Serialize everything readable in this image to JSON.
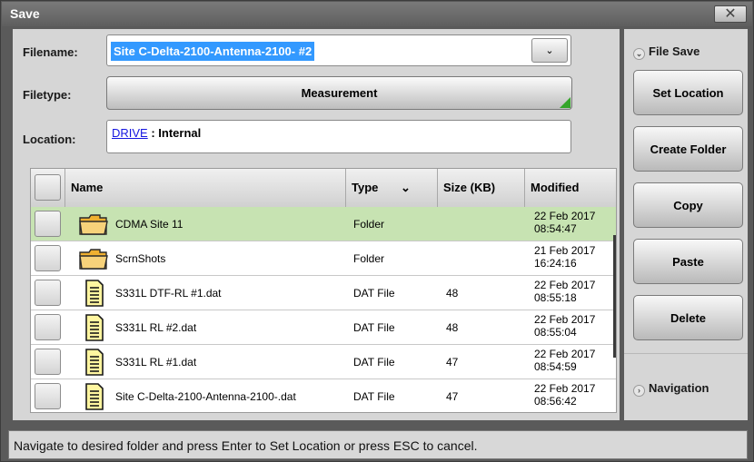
{
  "window": {
    "title": "Save",
    "close_glyph": "✕"
  },
  "form": {
    "filename_label": "Filename:",
    "filename_value": "Site C-Delta-2100-Antenna-2100- #2",
    "dropdown_glyph": "⌄",
    "filetype_label": "Filetype:",
    "filetype_value": "Measurement",
    "location_label": "Location:",
    "location_link": "DRIVE",
    "location_rest": " : Internal"
  },
  "table": {
    "columns": {
      "name": "Name",
      "type": "Type",
      "size": "Size (KB)",
      "modified": "Modified"
    },
    "type_sort_glyph": "⌄",
    "rows": [
      {
        "icon": "folder-icon",
        "name": "CDMA Site 11",
        "type": "Folder",
        "size": "",
        "modified_date": "22 Feb 2017",
        "modified_time": "08:54:47"
      },
      {
        "icon": "folder-icon",
        "name": "ScrnShots",
        "type": "Folder",
        "size": "",
        "modified_date": "21 Feb 2017",
        "modified_time": "16:24:16"
      },
      {
        "icon": "file-icon",
        "name": "S331L DTF-RL #1.dat",
        "type": "DAT File",
        "size": "48",
        "modified_date": "22 Feb 2017",
        "modified_time": "08:55:18"
      },
      {
        "icon": "file-icon",
        "name": "S331L RL #2.dat",
        "type": "DAT File",
        "size": "48",
        "modified_date": "22 Feb 2017",
        "modified_time": "08:55:04"
      },
      {
        "icon": "file-icon",
        "name": "S331L RL #1.dat",
        "type": "DAT File",
        "size": "47",
        "modified_date": "22 Feb 2017",
        "modified_time": "08:54:59"
      },
      {
        "icon": "file-icon",
        "name": "Site C-Delta-2100-Antenna-2100-.dat",
        "type": "DAT File",
        "size": "47",
        "modified_date": "22 Feb 2017",
        "modified_time": "08:56:42"
      }
    ]
  },
  "side": {
    "file_save_label": "File Save",
    "file_save_glyph": "⌄",
    "set_location": "Set Location",
    "create_folder": "Create Folder",
    "copy": "Copy",
    "paste": "Paste",
    "delete": "Delete",
    "navigation_label": "Navigation",
    "navigation_glyph": "›"
  },
  "status": {
    "text": "Navigate to desired folder and press Enter to Set Location or press ESC to cancel."
  },
  "colors": {
    "selected_row": "#c7e3b2",
    "title_bar": "#6a6a6a",
    "link": "#1616e0",
    "filename_highlight": "#3399ff",
    "corner_indicator": "#35a52a"
  }
}
